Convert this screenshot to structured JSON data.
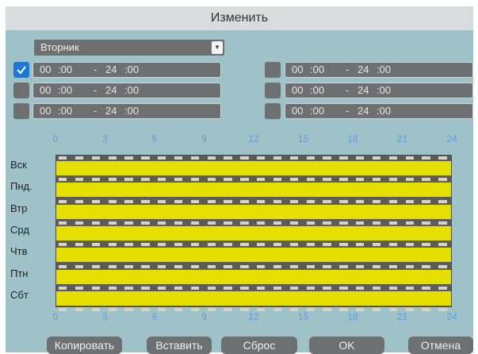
{
  "dialog": {
    "title": "Изменить"
  },
  "day_select": {
    "value": "Вторник"
  },
  "time_ranges": [
    {
      "checked": true,
      "start_h": "00",
      "start_m": ":00",
      "dash": "-",
      "end_h": "24",
      "end_m": ":00"
    },
    {
      "checked": false,
      "start_h": "00",
      "start_m": ":00",
      "dash": "-",
      "end_h": "24",
      "end_m": ":00"
    },
    {
      "checked": false,
      "start_h": "00",
      "start_m": ":00",
      "dash": "-",
      "end_h": "24",
      "end_m": ":00"
    },
    {
      "checked": false,
      "start_h": "00",
      "start_m": ":00",
      "dash": "-",
      "end_h": "24",
      "end_m": ":00"
    },
    {
      "checked": false,
      "start_h": "00",
      "start_m": ":00",
      "dash": "-",
      "end_h": "24",
      "end_m": ":00"
    },
    {
      "checked": false,
      "start_h": "00",
      "start_m": ":00",
      "dash": "-",
      "end_h": "24",
      "end_m": ":00"
    }
  ],
  "hours": [
    "0",
    "3",
    "6",
    "9",
    "12",
    "15",
    "18",
    "21",
    "24"
  ],
  "days": [
    "Вск",
    "Пнд.",
    "Втр",
    "Срд",
    "Чтв",
    "Птн",
    "Сбт"
  ],
  "buttons": {
    "copy": "Копировать",
    "paste": "Вставить",
    "reset": "Сброс",
    "ok": "OK",
    "cancel": "Отмена"
  },
  "colors": {
    "schedule_fill": "#e6e000",
    "accent": "#1f77d4"
  }
}
